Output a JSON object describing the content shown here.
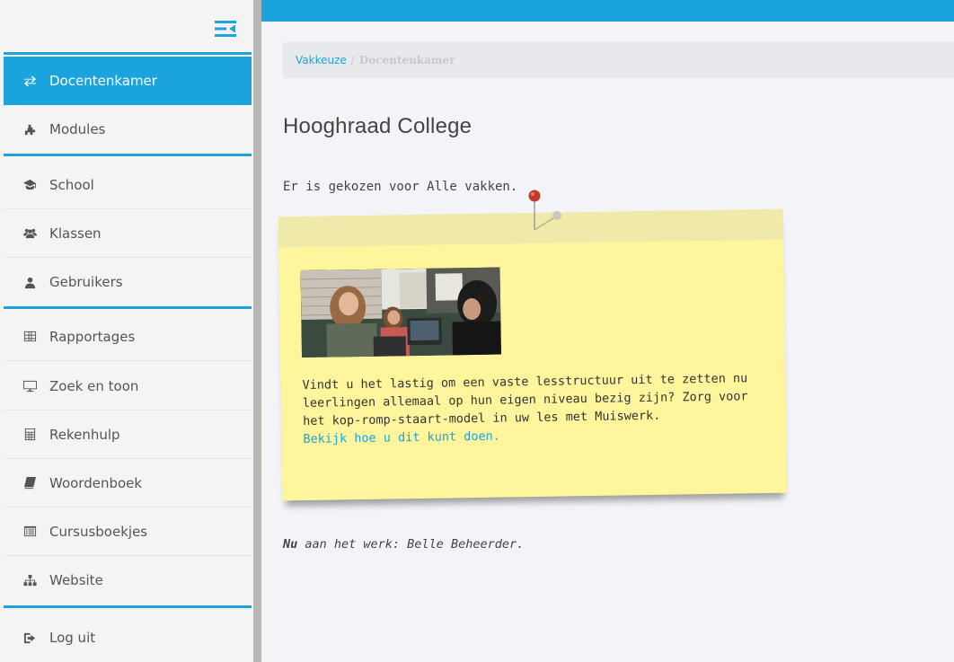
{
  "sidebar": {
    "items": [
      {
        "label": "Docentenkamer",
        "icon": "exchange-icon",
        "active": true
      },
      {
        "label": "Modules",
        "icon": "puzzle-icon"
      },
      {
        "label": "School",
        "icon": "graduation-cap-icon"
      },
      {
        "label": "Klassen",
        "icon": "users-icon"
      },
      {
        "label": "Gebruikers",
        "icon": "user-icon"
      },
      {
        "label": "Rapportages",
        "icon": "table-icon"
      },
      {
        "label": "Zoek en toon",
        "icon": "monitor-icon"
      },
      {
        "label": "Rekenhulp",
        "icon": "calculator-icon"
      },
      {
        "label": "Woordenboek",
        "icon": "book-icon"
      },
      {
        "label": "Cursusboekjes",
        "icon": "list-alt-icon"
      },
      {
        "label": "Website",
        "icon": "sitemap-icon"
      },
      {
        "label": "Log uit",
        "icon": "sign-out-icon"
      }
    ]
  },
  "breadcrumb": {
    "link": "Vakkeuze",
    "separator": "/",
    "current": "Docentenkamer"
  },
  "main": {
    "title": "Hooghraad College",
    "choice_text": "Er is gekozen voor Alle vakken.",
    "note": {
      "text": "Vindt u het lastig om een vaste lesstructuur uit te zetten nu leerlingen allemaal op hun eigen niveau bezig zijn? Zorg voor het kop-romp-staart-model in uw les met Muiswerk.",
      "link": "Bekijk hoe u dit kunt doen."
    },
    "footer_strong": "Nu",
    "footer_rest": " aan het werk: Belle Beheerder."
  },
  "colors": {
    "accent": "#1aa3dd",
    "note_bg": "#fff59c",
    "note_strip": "#efeaaa"
  }
}
